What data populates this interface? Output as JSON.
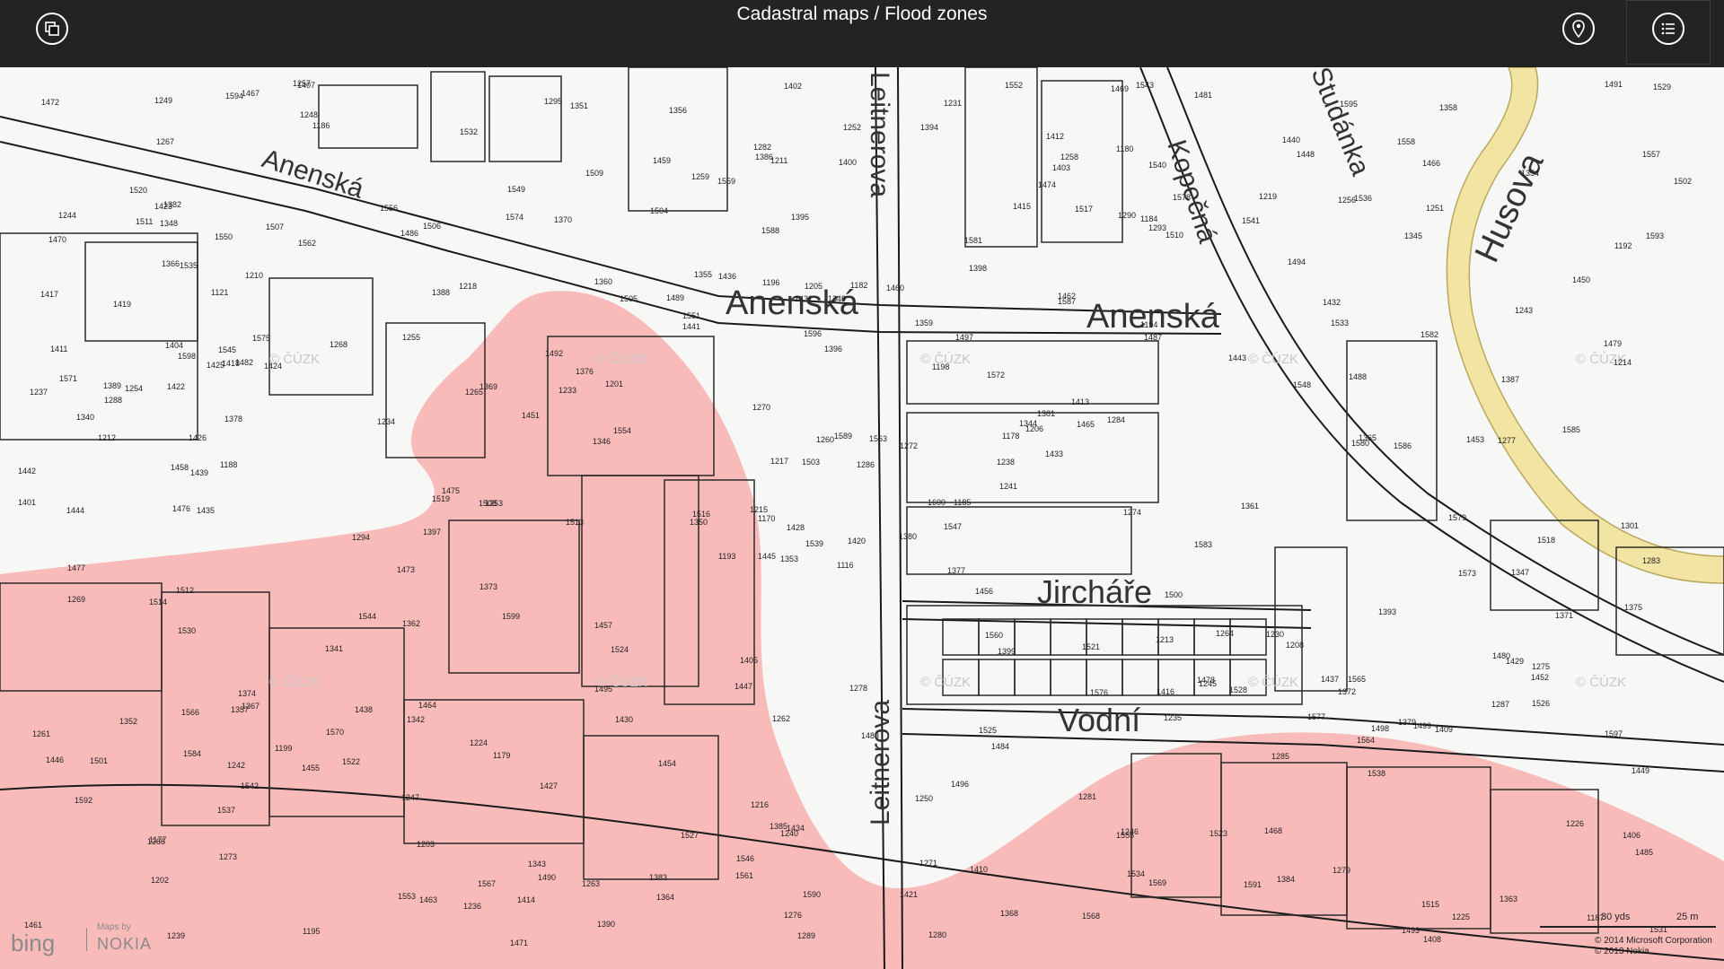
{
  "app": {
    "title": "Cadastral maps / Flood zones"
  },
  "toolbar": {
    "layers_button_icon": "layers-icon",
    "locate_button_icon": "location-pin-icon",
    "list_button_icon": "list-icon"
  },
  "map": {
    "streets": {
      "anenska_upper_left": "Anenská",
      "anenska_center": "Anenská",
      "anenska_right": "Anenská",
      "leitnerova_upper": "Leitnerova",
      "leitnerova_lower": "Leitnerova",
      "kopecna": "Kopečná",
      "studanka": "Studánka",
      "husova": "Husova",
      "jircha": "Jircháře",
      "vodni": "Vodní"
    },
    "parcels": [
      "1116",
      "1121",
      "1170",
      "1177",
      "1178",
      "1179",
      "1180",
      "1182",
      "1184",
      "1185",
      "1186",
      "1187",
      "1188",
      "1192",
      "1193",
      "1194",
      "1195",
      "1196",
      "1198",
      "1199",
      "1201",
      "1202",
      "1203",
      "1205",
      "1206",
      "1208",
      "1210",
      "1211",
      "1212",
      "1213",
      "1214",
      "1215",
      "1216",
      "1217",
      "1218",
      "1219",
      "1224",
      "1225",
      "1226",
      "1230",
      "1231",
      "1233",
      "1234",
      "1235",
      "1236",
      "1237",
      "1238",
      "1239",
      "1240",
      "1241",
      "1242",
      "1243",
      "1244",
      "1245",
      "1246",
      "1247",
      "1248",
      "1249",
      "1250",
      "1251",
      "1252",
      "1253",
      "1254",
      "1255",
      "1256",
      "1257",
      "1258",
      "1259",
      "1260",
      "1261",
      "1262",
      "1263",
      "1264",
      "1265",
      "1266",
      "1267",
      "1268",
      "1269",
      "1270",
      "1271",
      "1272",
      "1273",
      "1274",
      "1275",
      "1276",
      "1277",
      "1278",
      "1279",
      "1280",
      "1281",
      "1282",
      "1283",
      "1284",
      "1285",
      "1286",
      "1287",
      "1288",
      "1289",
      "1290",
      "1293",
      "1294",
      "1295",
      "1301",
      "1340",
      "1341",
      "1342",
      "1343",
      "1344",
      "1345",
      "1346",
      "1347",
      "1348",
      "1349",
      "1350",
      "1351",
      "1352",
      "1353",
      "1354",
      "1355",
      "1356",
      "1357",
      "1358",
      "1359",
      "1360",
      "1361",
      "1362",
      "1363",
      "1364",
      "1365",
      "1366",
      "1367",
      "1368",
      "1369",
      "1370",
      "1371",
      "1372",
      "1373",
      "1374",
      "1375",
      "1376",
      "1377",
      "1378",
      "1379",
      "1380",
      "1381",
      "1382",
      "1383",
      "1384",
      "1385",
      "1386",
      "1387",
      "1388",
      "1389",
      "1390",
      "1393",
      "1394",
      "1395",
      "1396",
      "1397",
      "1398",
      "1399",
      "1400",
      "1401",
      "1402",
      "1403",
      "1404",
      "1405",
      "1406",
      "1407",
      "1408",
      "1409",
      "1410",
      "1411",
      "1412",
      "1413",
      "1414",
      "1415",
      "1416",
      "1417",
      "1418",
      "1419",
      "1420",
      "1421",
      "1422",
      "1423",
      "1424",
      "1425",
      "1426",
      "1427",
      "1428",
      "1429",
      "1430",
      "1431",
      "1432",
      "1433",
      "1434",
      "1435",
      "1436",
      "1437",
      "1438",
      "1439",
      "1440",
      "1441",
      "1442",
      "1443",
      "1444",
      "1445",
      "1446",
      "1447",
      "1448",
      "1449",
      "1450",
      "1451",
      "1452",
      "1453",
      "1454",
      "1455",
      "1456",
      "1457",
      "1458",
      "1459",
      "1460",
      "1461",
      "1462",
      "1463",
      "1464",
      "1465",
      "1466",
      "1467",
      "1468",
      "1469",
      "1470",
      "1471",
      "1472",
      "1473",
      "1474",
      "1475",
      "1476",
      "1477",
      "1478",
      "1479",
      "1480",
      "1481",
      "1482",
      "1483",
      "1484",
      "1485",
      "1486",
      "1487",
      "1488",
      "1489",
      "1490",
      "1491",
      "1492",
      "1493",
      "1494",
      "1495",
      "1496",
      "1497",
      "1498",
      "1499",
      "1500",
      "1501",
      "1502",
      "1503",
      "1504",
      "1505",
      "1506",
      "1507",
      "1508",
      "1509",
      "1510",
      "1511",
      "1512",
      "1513",
      "1514",
      "1515",
      "1516",
      "1517",
      "1518",
      "1519",
      "1520",
      "1521",
      "1522",
      "1523",
      "1524",
      "1525",
      "1526",
      "1527",
      "1528",
      "1529",
      "1530",
      "1531",
      "1532",
      "1533",
      "1534",
      "1535",
      "1536",
      "1537",
      "1538",
      "1539",
      "1540",
      "1541",
      "1542",
      "1543",
      "1544",
      "1545",
      "1546",
      "1547",
      "1548",
      "1549",
      "1550",
      "1551",
      "1552",
      "1553",
      "1554",
      "1555",
      "1556",
      "1557",
      "1558",
      "1559",
      "1560",
      "1561",
      "1562",
      "1563",
      "1564",
      "1565",
      "1566",
      "1567",
      "1568",
      "1569",
      "1570",
      "1571",
      "1572",
      "1573",
      "1574",
      "1575",
      "1576",
      "1577",
      "1578",
      "1579",
      "1580",
      "1581",
      "1582",
      "1583",
      "1584",
      "1585",
      "1586",
      "1587",
      "1588",
      "1589",
      "1590",
      "1591",
      "1592",
      "1593",
      "1594",
      "1595",
      "1596",
      "1597",
      "1598",
      "1599",
      "1600"
    ],
    "watermark": "© ČÚZK",
    "flood_zone_color": "#f7b4b4",
    "husova_road_color": "#f2e4a2"
  },
  "branding": {
    "bing": "bing",
    "maps_by": "Maps by",
    "nokia": "NOKIA"
  },
  "scale": {
    "yds": "30 yds",
    "m": "25 m"
  },
  "copyright": {
    "line1": "© 2014 Microsoft Corporation",
    "line2": "© 2013 Nokia"
  }
}
